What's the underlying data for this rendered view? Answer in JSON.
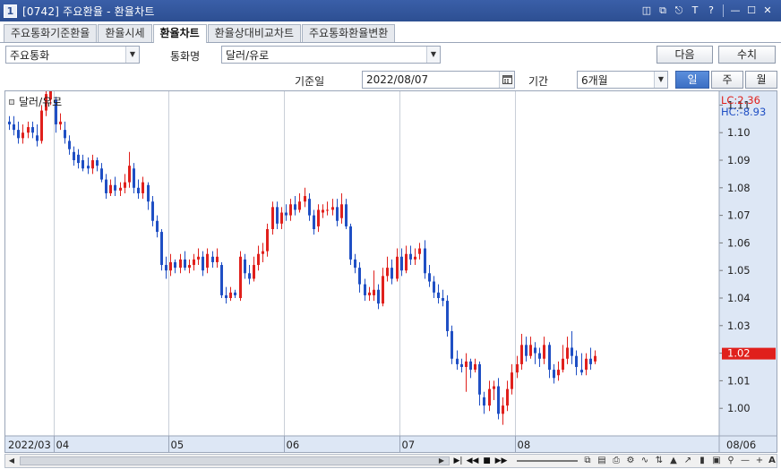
{
  "window": {
    "number": "1",
    "title": "[0742] 주요환율 - 환율차트",
    "title_buttons": [
      "restore-window-icon",
      "duplicate-window-icon",
      "pin-icon",
      "font-icon",
      "help-icon",
      "minimize-icon",
      "maximize-icon",
      "close-icon"
    ]
  },
  "tabs": [
    {
      "label": "주요통화기준환율",
      "active": false
    },
    {
      "label": "환율시세",
      "active": false
    },
    {
      "label": "환율차트",
      "active": true
    },
    {
      "label": "환율상대비교차트",
      "active": false
    },
    {
      "label": "주요통화환율변환",
      "active": false
    }
  ],
  "controls": {
    "currency_group": "주요통화",
    "currency_label": "통화명",
    "currency_pair": "달러/유로",
    "next_button": "다음",
    "values_button": "수치",
    "base_date_label": "기준일",
    "base_date": "2022/08/07",
    "period_label": "기간",
    "period": "6개월",
    "interval_buttons": [
      {
        "label": "일",
        "active": true
      },
      {
        "label": "주",
        "active": false
      },
      {
        "label": "월",
        "active": false
      }
    ]
  },
  "chart_data": {
    "type": "candlestick",
    "legend": "달러/유로",
    "lc_label": "LC:2.36",
    "hc_label": "HC:-8.93",
    "current_price_label": "1.02",
    "current_price": 1.02,
    "y_ticks": [
      "1.11",
      "1.10",
      "1.09",
      "1.08",
      "1.07",
      "1.06",
      "1.05",
      "1.04",
      "1.03",
      "1.02",
      "1.01",
      "1.00"
    ],
    "ylim": [
      0.99,
      1.115
    ],
    "x_ticks": [
      {
        "label": "2022/03",
        "index": 0
      },
      {
        "label": "04",
        "index": 10
      },
      {
        "label": "05",
        "index": 35
      },
      {
        "label": "06",
        "index": 60
      },
      {
        "label": "07",
        "index": 85
      },
      {
        "label": "08",
        "index": 110
      }
    ],
    "end_date_label": "08/06",
    "up_color": "#e0201c",
    "down_color": "#1f4fc4",
    "candles": [
      [
        1.104,
        1.103,
        1.106,
        1.101
      ],
      [
        1.103,
        1.101,
        1.106,
        1.099
      ],
      [
        1.101,
        1.098,
        1.104,
        1.096
      ],
      [
        1.098,
        1.1,
        1.103,
        1.096
      ],
      [
        1.1,
        1.102,
        1.104,
        1.098
      ],
      [
        1.102,
        1.1,
        1.104,
        1.098
      ],
      [
        1.099,
        1.097,
        1.103,
        1.095
      ],
      [
        1.097,
        1.108,
        1.11,
        1.096
      ],
      [
        1.108,
        1.114,
        1.115,
        1.106
      ],
      [
        1.112,
        1.115,
        1.117,
        1.11
      ],
      [
        1.112,
        1.103,
        1.113,
        1.1
      ],
      [
        1.103,
        1.104,
        1.107,
        1.101
      ],
      [
        1.101,
        1.098,
        1.104,
        1.096
      ],
      [
        1.097,
        1.094,
        1.099,
        1.092
      ],
      [
        1.093,
        1.09,
        1.095,
        1.088
      ],
      [
        1.092,
        1.089,
        1.094,
        1.087
      ],
      [
        1.09,
        1.087,
        1.092,
        1.086
      ],
      [
        1.088,
        1.087,
        1.091,
        1.085
      ],
      [
        1.087,
        1.09,
        1.092,
        1.085
      ],
      [
        1.09,
        1.088,
        1.091,
        1.086
      ],
      [
        1.087,
        1.083,
        1.089,
        1.082
      ],
      [
        1.083,
        1.078,
        1.085,
        1.076
      ],
      [
        1.078,
        1.081,
        1.083,
        1.077
      ],
      [
        1.081,
        1.079,
        1.084,
        1.077
      ],
      [
        1.079,
        1.08,
        1.082,
        1.077
      ],
      [
        1.08,
        1.082,
        1.085,
        1.078
      ],
      [
        1.082,
        1.088,
        1.093,
        1.08
      ],
      [
        1.087,
        1.08,
        1.089,
        1.078
      ],
      [
        1.08,
        1.078,
        1.083,
        1.076
      ],
      [
        1.078,
        1.082,
        1.084,
        1.076
      ],
      [
        1.081,
        1.075,
        1.082,
        1.072
      ],
      [
        1.075,
        1.068,
        1.077,
        1.066
      ],
      [
        1.068,
        1.064,
        1.07,
        1.062
      ],
      [
        1.064,
        1.052,
        1.065,
        1.05
      ],
      [
        1.052,
        1.05,
        1.055,
        1.047
      ],
      [
        1.05,
        1.053,
        1.056,
        1.048
      ],
      [
        1.053,
        1.051,
        1.054,
        1.049
      ],
      [
        1.051,
        1.054,
        1.056,
        1.049
      ],
      [
        1.054,
        1.051,
        1.057,
        1.05
      ],
      [
        1.051,
        1.052,
        1.054,
        1.049
      ],
      [
        1.052,
        1.054,
        1.056,
        1.05
      ],
      [
        1.054,
        1.055,
        1.058,
        1.052
      ],
      [
        1.055,
        1.05,
        1.057,
        1.048
      ],
      [
        1.051,
        1.056,
        1.058,
        1.049
      ],
      [
        1.055,
        1.053,
        1.057,
        1.051
      ],
      [
        1.053,
        1.055,
        1.058,
        1.051
      ],
      [
        1.052,
        1.041,
        1.053,
        1.04
      ],
      [
        1.041,
        1.04,
        1.044,
        1.038
      ],
      [
        1.04,
        1.042,
        1.044,
        1.039
      ],
      [
        1.042,
        1.041,
        1.043,
        1.04
      ],
      [
        1.04,
        1.055,
        1.057,
        1.039
      ],
      [
        1.054,
        1.049,
        1.056,
        1.047
      ],
      [
        1.049,
        1.047,
        1.052,
        1.045
      ],
      [
        1.047,
        1.052,
        1.055,
        1.046
      ],
      [
        1.052,
        1.056,
        1.059,
        1.05
      ],
      [
        1.056,
        1.057,
        1.06,
        1.053
      ],
      [
        1.057,
        1.065,
        1.067,
        1.055
      ],
      [
        1.065,
        1.073,
        1.075,
        1.063
      ],
      [
        1.073,
        1.067,
        1.075,
        1.065
      ],
      [
        1.067,
        1.071,
        1.073,
        1.065
      ],
      [
        1.071,
        1.07,
        1.074,
        1.068
      ],
      [
        1.07,
        1.074,
        1.076,
        1.068
      ],
      [
        1.074,
        1.072,
        1.077,
        1.07
      ],
      [
        1.072,
        1.075,
        1.078,
        1.071
      ],
      [
        1.075,
        1.077,
        1.08,
        1.073
      ],
      [
        1.076,
        1.07,
        1.078,
        1.068
      ],
      [
        1.07,
        1.065,
        1.072,
        1.063
      ],
      [
        1.066,
        1.072,
        1.074,
        1.064
      ],
      [
        1.071,
        1.072,
        1.074,
        1.069
      ],
      [
        1.072,
        1.072,
        1.075,
        1.07
      ],
      [
        1.072,
        1.073,
        1.076,
        1.07
      ],
      [
        1.073,
        1.068,
        1.076,
        1.066
      ],
      [
        1.069,
        1.074,
        1.078,
        1.067
      ],
      [
        1.074,
        1.066,
        1.076,
        1.065
      ],
      [
        1.066,
        1.054,
        1.067,
        1.052
      ],
      [
        1.054,
        1.051,
        1.056,
        1.049
      ],
      [
        1.051,
        1.045,
        1.053,
        1.042
      ],
      [
        1.045,
        1.041,
        1.047,
        1.039
      ],
      [
        1.041,
        1.042,
        1.044,
        1.039
      ],
      [
        1.041,
        1.043,
        1.05,
        1.039
      ],
      [
        1.043,
        1.038,
        1.045,
        1.036
      ],
      [
        1.038,
        1.048,
        1.051,
        1.037
      ],
      [
        1.048,
        1.051,
        1.055,
        1.046
      ],
      [
        1.051,
        1.047,
        1.054,
        1.045
      ],
      [
        1.047,
        1.055,
        1.058,
        1.046
      ],
      [
        1.055,
        1.05,
        1.058,
        1.048
      ],
      [
        1.05,
        1.056,
        1.059,
        1.049
      ],
      [
        1.056,
        1.054,
        1.059,
        1.052
      ],
      [
        1.054,
        1.055,
        1.058,
        1.052
      ],
      [
        1.056,
        1.058,
        1.06,
        1.054
      ],
      [
        1.058,
        1.049,
        1.061,
        1.047
      ],
      [
        1.049,
        1.046,
        1.052,
        1.044
      ],
      [
        1.046,
        1.042,
        1.048,
        1.04
      ],
      [
        1.042,
        1.04,
        1.045,
        1.038
      ],
      [
        1.04,
        1.039,
        1.043,
        1.037
      ],
      [
        1.039,
        1.028,
        1.041,
        1.026
      ],
      [
        1.028,
        1.018,
        1.03,
        1.016
      ],
      [
        1.018,
        1.016,
        1.021,
        1.014
      ],
      [
        1.016,
        1.015,
        1.018,
        1.013
      ],
      [
        1.015,
        1.017,
        1.02,
        1.006
      ],
      [
        1.017,
        1.014,
        1.018,
        1.011
      ],
      [
        1.014,
        1.016,
        1.018,
        1.013
      ],
      [
        1.016,
        1.005,
        1.017,
        1.001
      ],
      [
        1.004,
        1.001,
        1.006,
        0.998
      ],
      [
        1.001,
        1.007,
        1.01,
        0.999
      ],
      [
        1.007,
        1.008,
        1.01,
        1.003
      ],
      [
        1.008,
        0.998,
        1.011,
        0.996
      ],
      [
        0.998,
        1.001,
        1.004,
        0.994
      ],
      [
        1.001,
        1.007,
        1.01,
        0.999
      ],
      [
        1.007,
        1.013,
        1.016,
        1.005
      ],
      [
        1.013,
        1.016,
        1.019,
        1.011
      ],
      [
        1.016,
        1.023,
        1.027,
        1.014
      ],
      [
        1.023,
        1.019,
        1.026,
        1.017
      ],
      [
        1.019,
        1.023,
        1.026,
        1.018
      ],
      [
        1.022,
        1.02,
        1.024,
        1.016
      ],
      [
        1.02,
        1.018,
        1.022,
        1.015
      ],
      [
        1.018,
        1.023,
        1.026,
        1.016
      ],
      [
        1.023,
        1.014,
        1.024,
        1.011
      ],
      [
        1.014,
        1.011,
        1.016,
        1.009
      ],
      [
        1.012,
        1.014,
        1.017,
        1.01
      ],
      [
        1.014,
        1.018,
        1.023,
        1.013
      ],
      [
        1.018,
        1.022,
        1.026,
        1.016
      ],
      [
        1.022,
        1.019,
        1.028,
        1.016
      ],
      [
        1.019,
        1.015,
        1.021,
        1.012
      ],
      [
        1.014,
        1.013,
        1.02,
        1.012
      ],
      [
        1.014,
        1.018,
        1.02,
        1.012
      ],
      [
        1.018,
        1.016,
        1.022,
        1.014
      ],
      [
        1.017,
        1.019,
        1.021,
        1.016
      ]
    ]
  },
  "scrollbar": {
    "nav_buttons": [
      "last-page-icon",
      "rewind-icon",
      "stop-icon",
      "forward-icon"
    ],
    "tools": [
      "copy-chart-icon",
      "save-chart-icon",
      "print-icon",
      "settings-icon",
      "line-chart-icon",
      "candle-chart-icon",
      "area-chart-icon",
      "trend-icon",
      "bar-chart-icon",
      "fullscreen-icon",
      "magnifier-icon",
      "zoom-out-icon",
      "zoom-in-icon",
      "font-size-icon"
    ]
  }
}
